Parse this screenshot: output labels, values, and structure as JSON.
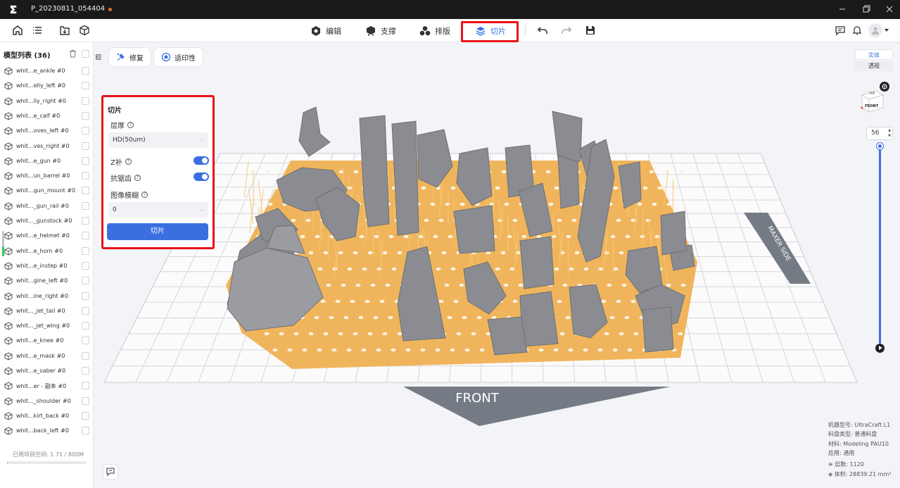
{
  "window": {
    "title": "P_20230811_054404"
  },
  "toolbar": {
    "tabs": [
      {
        "label": "编辑",
        "icon": "gear-cube-icon"
      },
      {
        "label": "支撑",
        "icon": "support-icon"
      },
      {
        "label": "排版",
        "icon": "layout-icon"
      },
      {
        "label": "切片",
        "icon": "layers-icon",
        "active": true
      }
    ],
    "accent": "#3b6fe0",
    "highlight": "#e8131a"
  },
  "left_panel": {
    "header": "模型列表 (36)",
    "models": [
      "whit...e_ankle #0",
      "whit...elly_left #0",
      "whit...lly_right #0",
      "whit...e_calf #0",
      "whit...oves_left #0",
      "whit...ves_right #0",
      "whit...e_gun #0",
      "whit...un_barrel #0",
      "whit...gun_mount #0",
      "whit..._gun_rail #0",
      "whit..._gunstock #0",
      "whit...e_helmet #0",
      "whit...e_horn #0",
      "whit...e_instep #0",
      "whit...gine_left #0",
      "whit...ine_right #0",
      "whit..._jet_tail #0",
      "whit..._jet_wing #0",
      "whit...e_knee #0",
      "whit...e_mask #0",
      "whit...e_saber #0",
      "whit...er - 副本 #0",
      "whit..._shoulder #0",
      "whit...kirt_back #0",
      "whit...back_left #0"
    ],
    "space_used": "已用项目空间: 1.71 / 800M",
    "space_fraction": 0.002
  },
  "viewport": {
    "repair_label": "修复",
    "printability_label": "适印性",
    "front_label": "FRONT",
    "side_label": "MAXER SIDE"
  },
  "slice_panel": {
    "title": "切片",
    "layer_thickness_label": "层厚",
    "layer_thickness_value": "HD(50um)",
    "z_comp_label": "Z补",
    "z_comp_on": true,
    "antialias_label": "抗锯齿",
    "antialias_on": true,
    "blur_label": "图像模糊",
    "blur_value": "0",
    "slice_button": "切片"
  },
  "right_panel": {
    "view_solid": "实体",
    "view_perspective": "透视",
    "cube_top": "TOP",
    "cube_front": "FRONT",
    "layer_value": "56"
  },
  "info": {
    "machine": "机器型号: UltraCraft L1",
    "tray": "料盘类型: 普通料盘",
    "material": "材料: Modeling PAU10",
    "application": "应用: 通用",
    "layers": "层数: 1120",
    "volume": "体积: 28839.21 mm³"
  }
}
